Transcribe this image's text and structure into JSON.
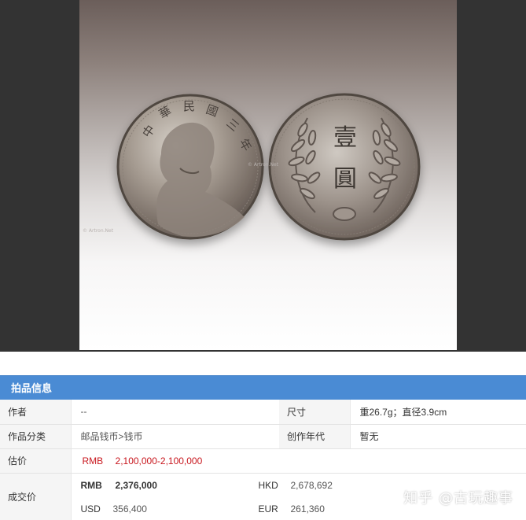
{
  "panel": {
    "title": "拍品信息"
  },
  "rows": {
    "author": {
      "label": "作者",
      "value": "--"
    },
    "size": {
      "label": "尺寸",
      "value": "重26.7g；直径3.9cm"
    },
    "category": {
      "label": "作品分类",
      "value": "邮品钱币>钱币"
    },
    "year": {
      "label": "创作年代",
      "value": "暂无"
    },
    "estimate": {
      "label": "估价",
      "currency": "RMB",
      "value": "2,100,000-2,100,000"
    },
    "sold": {
      "label": "成交价",
      "rmb": {
        "code": "RMB",
        "amount": "2,376,000"
      },
      "hkd": {
        "code": "HKD",
        "amount": "2,678,692"
      },
      "usd": {
        "code": "USD",
        "amount": "356,400"
      },
      "eur": {
        "code": "EUR",
        "amount": "261,360"
      }
    }
  },
  "coin": {
    "obverse_legend": "中華民國三年",
    "reverse_legend": "壹圓"
  },
  "watermark": "知乎 @古玩趣事",
  "colors": {
    "header_bg": "#4a8bd4",
    "price_red": "#c8161d",
    "label_bg": "#f5f5f5"
  }
}
